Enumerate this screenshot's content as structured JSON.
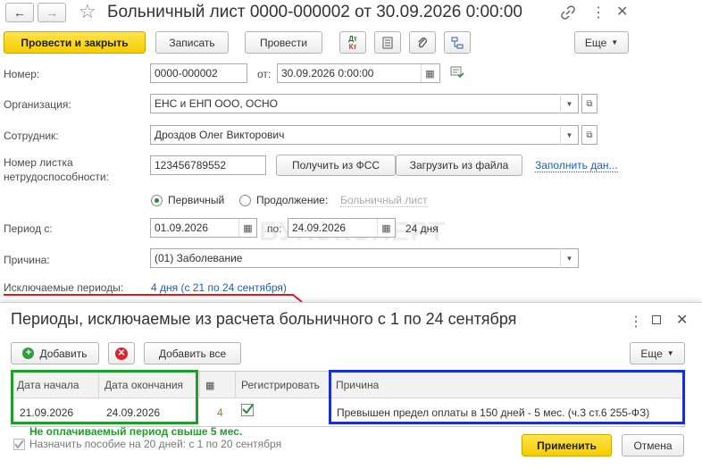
{
  "window": {
    "title": "Больничный лист 0000-000002 от 30.09.2026 0:00:00",
    "nav_back": "←",
    "nav_forward": "→",
    "star": "☆",
    "link_icon": "link-icon",
    "menu_icon": "more-vertical-icon",
    "close": "✕"
  },
  "toolbar": {
    "post_close": "Провести и закрыть",
    "save": "Записать",
    "post": "Провести",
    "dt_label": "Дт",
    "kt_label": "Кт",
    "more": "Еще"
  },
  "form": {
    "number_label": "Номер:",
    "number_value": "0000-000002",
    "date_label": "от:",
    "date_value": "30.09.2026  0:00:00",
    "org_label": "Организация:",
    "org_value": "ЕНС и ЕНП ООО, ОСНО",
    "employee_label": "Сотрудник:",
    "employee_value": "Дроздов Олег Викторович",
    "sheet_label_1": "Номер листка",
    "sheet_label_2": "нетрудоспособности:",
    "sheet_value": "123456789552",
    "get_fss": "Получить из ФСС",
    "load_file": "Загрузить из файла",
    "fill_link": "Заполнить дан...",
    "primary": "Первичный",
    "continuation": "Продолжение:",
    "continuation_link": "Больничный лист",
    "period_label": "Период с:",
    "period_from": "01.09.2026",
    "period_to_label": "по:",
    "period_to": "24.09.2026",
    "days": "24 дня",
    "reason_label": "Причина:",
    "reason_value": "(01) Заболевание",
    "excluded_label": "Исключаемые периоды:",
    "excluded_link": "4 дня (с 21 по 24 сентября)",
    "watermark": "БУХЭКСПЕРТ"
  },
  "dialog": {
    "title": "Периоды, исключаемые из расчета больничного с 1 по 24 сентября",
    "add": "Добавить",
    "add_all": "Добавить все",
    "more": "Еще",
    "columns": {
      "start": "Дата начала",
      "end": "Дата окончания",
      "register": "Регистрировать",
      "reason": "Причина"
    },
    "rows": [
      {
        "start": "21.09.2026",
        "end": "24.09.2026",
        "days": "4",
        "register": true,
        "reason": "Превышен предел оплаты в 150 дней - 5 мес. (ч.3 ст.6 255-ФЗ)"
      }
    ],
    "annotation": "Не оплачиваемый период свыше 5 мес.",
    "checkbox_label": "Назначить пособие на 20 дней: с 1 по 20 сентября",
    "apply": "Применить",
    "cancel": "Отмена"
  },
  "colors": {
    "highlight_green": "#1e9e2a",
    "highlight_blue": "#1a2fd0",
    "accent_yellow": "#f5cc00",
    "link_blue": "#1a5fb4"
  }
}
